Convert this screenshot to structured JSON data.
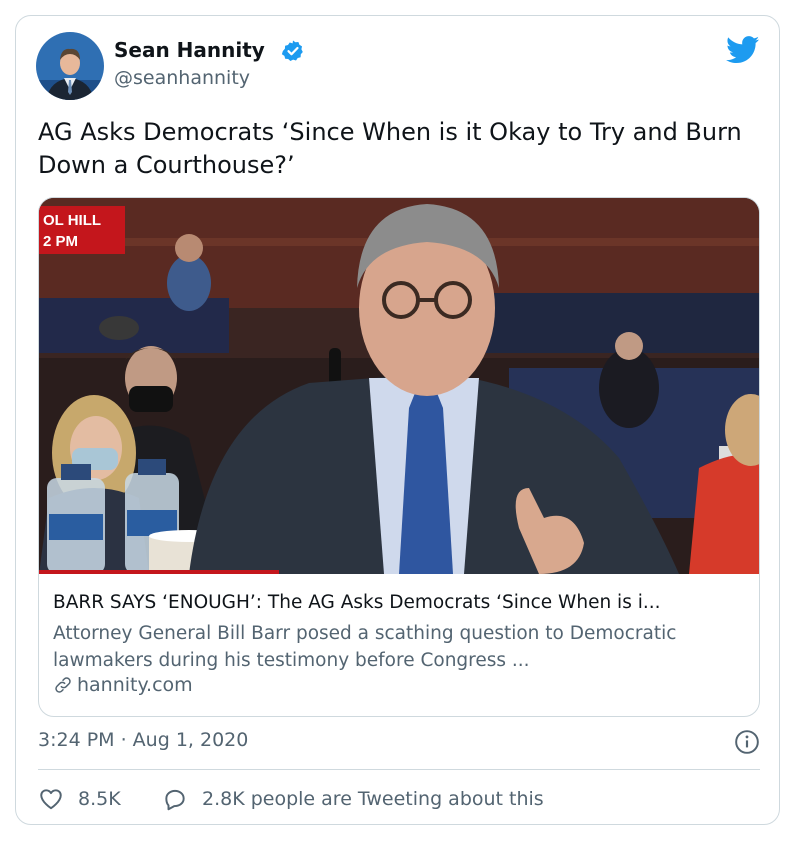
{
  "author": {
    "name": "Sean Hannity",
    "handle": "@seanhannity"
  },
  "tweet_text": "AG Asks Democrats ‘Since When is it Okay to Try and Burn Down a Courthouse?’",
  "card": {
    "overlay_line1": "OL HILL",
    "overlay_line2": "2 PM",
    "title": "BARR SAYS ‘ENOUGH’: The AG Asks Democrats ‘Since When is i...",
    "description": "Attorney General Bill Barr posed a scathing question to Democratic lawmakers during his testimony before Congress ...",
    "domain": "hannity.com"
  },
  "timestamp": "3:24 PM · Aug 1, 2020",
  "likes": "8.5K",
  "replies_text": "2.8K people are Tweeting about this",
  "colors": {
    "accent": "#1d9bf0",
    "text": "#0f1419",
    "muted": "#536471",
    "border": "#cfd9de",
    "overlay_red": "#c4161c"
  },
  "icons": [
    "verified-badge-icon",
    "twitter-bird-icon",
    "link-icon",
    "info-icon",
    "heart-icon",
    "reply-bubble-icon"
  ]
}
